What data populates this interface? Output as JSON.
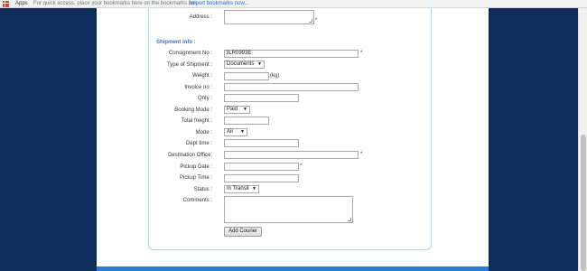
{
  "bookmarks_bar": {
    "apps_label": "Apps",
    "hint": "For quick access, place your bookmarks here on the bookmarks bar.",
    "import_link": "Import bookmarks now..."
  },
  "form": {
    "address": {
      "label": "Address :",
      "value": "",
      "required_mark": "*"
    },
    "section_title": "Shipment info :",
    "consignment": {
      "label": "Consignment No :",
      "value": "3LR0993E",
      "required_mark": "*"
    },
    "type_of_shipment": {
      "label": "Type of Shipment :",
      "selected": "Documents"
    },
    "weight": {
      "label": "Weight :",
      "value": "",
      "unit": "(kg)"
    },
    "invoice": {
      "label": "Invoice no :",
      "value": ""
    },
    "qnty": {
      "label": "Qnty :",
      "value": ""
    },
    "booking_mode": {
      "label": "Booking Mode :",
      "selected": "Paid"
    },
    "total_freight": {
      "label": "Total freight :",
      "value": ""
    },
    "mode": {
      "label": "Mode :",
      "selected": "Air"
    },
    "dept_time": {
      "label": "Dept time :",
      "value": ""
    },
    "destination_office": {
      "label": "Destination Office:",
      "value": "",
      "required_mark": "*"
    },
    "pickup_date": {
      "label": "Pickup Date :",
      "value": "",
      "required_mark": "*"
    },
    "pickup_time": {
      "label": "Pickup Time :",
      "value": ""
    },
    "status": {
      "label": "Status :",
      "selected": "In Transit"
    },
    "comments": {
      "label": "Comments :",
      "value": ""
    },
    "submit_label": "Add Courier"
  },
  "colors": {
    "background": "#0e2d5a",
    "section_title": "#3b73c4",
    "panel_border": "#a9d4ec",
    "footer_bar": "#2c7dcf"
  }
}
